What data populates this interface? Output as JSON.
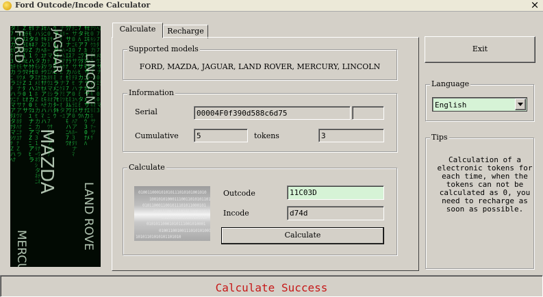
{
  "window": {
    "title": "Ford Outcode/Incode Calculator",
    "close_glyph": "×"
  },
  "side_image": {
    "brand_words": [
      "FORD",
      "JAGUAR",
      "MAZDA",
      "LINCOLN",
      "LAND ROVE",
      "MERCU"
    ]
  },
  "tabs": [
    {
      "label": "Calculate",
      "active": true
    },
    {
      "label": "Recharge",
      "active": false
    }
  ],
  "supported_models": {
    "title": "Supported models",
    "text": "FORD, MAZDA, JAGUAR, LAND ROVER, MERCURY, LINCOLN"
  },
  "information": {
    "title": "Information",
    "serial_label": "Serial",
    "serial_value": "00004F0f390d588c6d75",
    "serial_extra": "",
    "cumulative_label": "Cumulative",
    "cumulative_value": "5",
    "tokens_label": "tokens",
    "tokens_value": "3"
  },
  "calculate_group": {
    "title": "Calculate",
    "outcode_label": "Outcode",
    "outcode_value": "11C03D",
    "incode_label": "Incode",
    "incode_value": "d74d",
    "calculate_button": "Calculate",
    "binary_lines": [
      "010011000101010111010101001010",
      "1001010100011100110101011011",
      "0101100011001011101011000101",
      "0101110011010101100001011",
      "01100001010100101010",
      "01010110001010111001010001",
      "010011001001110101010010",
      "10101101010101101010"
    ]
  },
  "exit_button": "Exit",
  "language": {
    "title": "Language",
    "selected": "English"
  },
  "tips": {
    "title": "Tips",
    "text": "Calculation of a electronic tokens for each time, when the tokens can not be calculated as 0, you need to recharge as soon as possible."
  },
  "status": {
    "text": "Calculate Success",
    "color": "#c61818"
  },
  "colors": {
    "window_bg": "#d4d0c8",
    "highlight_field": "#d6f3d6",
    "matrix_green": "#22d64a"
  }
}
